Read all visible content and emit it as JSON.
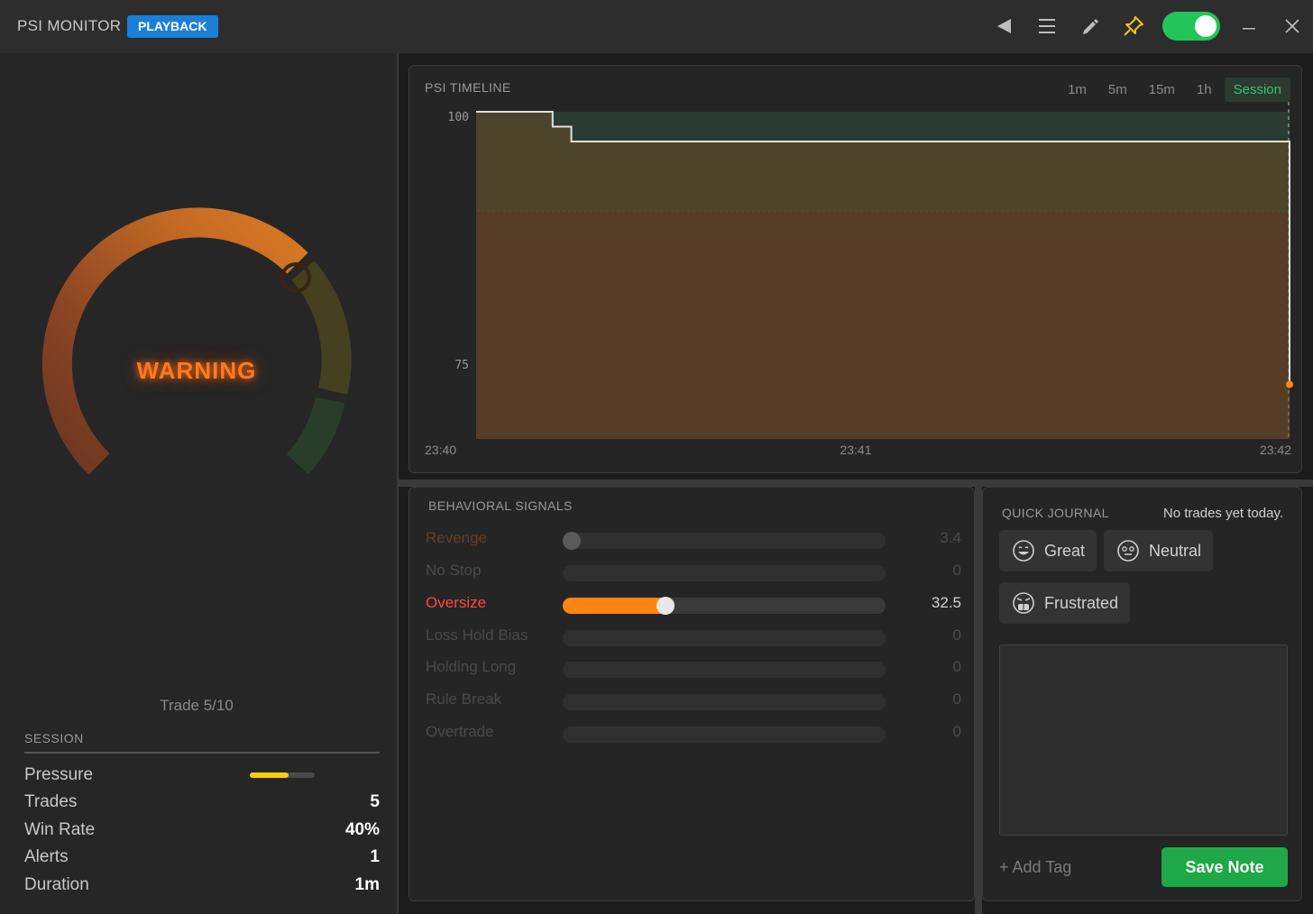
{
  "titlebar": {
    "app_title": "PSI MONITOR",
    "mode_badge": "PLAYBACK",
    "icons": [
      "back-icon",
      "menu-icon",
      "pencil-icon",
      "pin-icon"
    ],
    "toggle_on": true,
    "toggle_color": "#23c45a"
  },
  "gauge": {
    "status": "WARNING",
    "status_color": "#ff7a1a",
    "trade_counter": "Trade 5/10"
  },
  "session": {
    "header": "SESSION",
    "pressure_label": "Pressure",
    "pressure_level": 0.6,
    "pressure_color": "#f5cf0f",
    "trades_label": "Trades",
    "trades_value": "5",
    "win_rate_label": "Win Rate",
    "win_rate_value": "40%",
    "alerts_label": "Alerts",
    "alerts_value": "1",
    "duration_label": "Duration",
    "duration_value": "1m"
  },
  "timeline": {
    "title": "PSI TIMELINE",
    "ranges": [
      "1m",
      "5m",
      "15m",
      "1h",
      "Session"
    ],
    "active_range": "Session",
    "accent": "#38c46a"
  },
  "chart_data": {
    "type": "line",
    "title": "PSI TIMELINE",
    "x_ticks": [
      "23:40",
      "23:41",
      "23:42"
    ],
    "y_ticks": [
      100,
      75
    ],
    "ylim": [
      67,
      101
    ],
    "x": [
      0,
      0.094,
      0.117,
      0.645,
      1.0
    ],
    "y": [
      100,
      98.5,
      97,
      97,
      72.5
    ],
    "zones": [
      {
        "from": 90,
        "to": 100,
        "color": "#2a3b33"
      },
      {
        "from": 67,
        "to": 90,
        "color": "#3b3128"
      }
    ]
  },
  "signals": {
    "title": "BEHAVIORAL SIGNALS",
    "items": [
      {
        "label": "Revenge",
        "value": "3.4",
        "level": 0.034,
        "state": "dim-warn"
      },
      {
        "label": "No Stop",
        "value": "0",
        "level": 0,
        "state": "off"
      },
      {
        "label": "Oversize",
        "value": "32.5",
        "level": 0.325,
        "state": "active"
      },
      {
        "label": "Loss Hold Bias",
        "value": "0",
        "level": 0,
        "state": "off"
      },
      {
        "label": "Holding Long",
        "value": "0",
        "level": 0,
        "state": "off"
      },
      {
        "label": "Rule Break",
        "value": "0",
        "level": 0,
        "state": "off"
      },
      {
        "label": "Overtrade",
        "value": "0",
        "level": 0,
        "state": "off"
      }
    ]
  },
  "journal": {
    "title": "QUICK JOURNAL",
    "note": "No trades yet today.",
    "moods": [
      "Great",
      "Neutral",
      "Frustrated"
    ],
    "add_tag": "+ Add Tag",
    "save_label": "Save Note",
    "save_color": "#1fa847"
  }
}
